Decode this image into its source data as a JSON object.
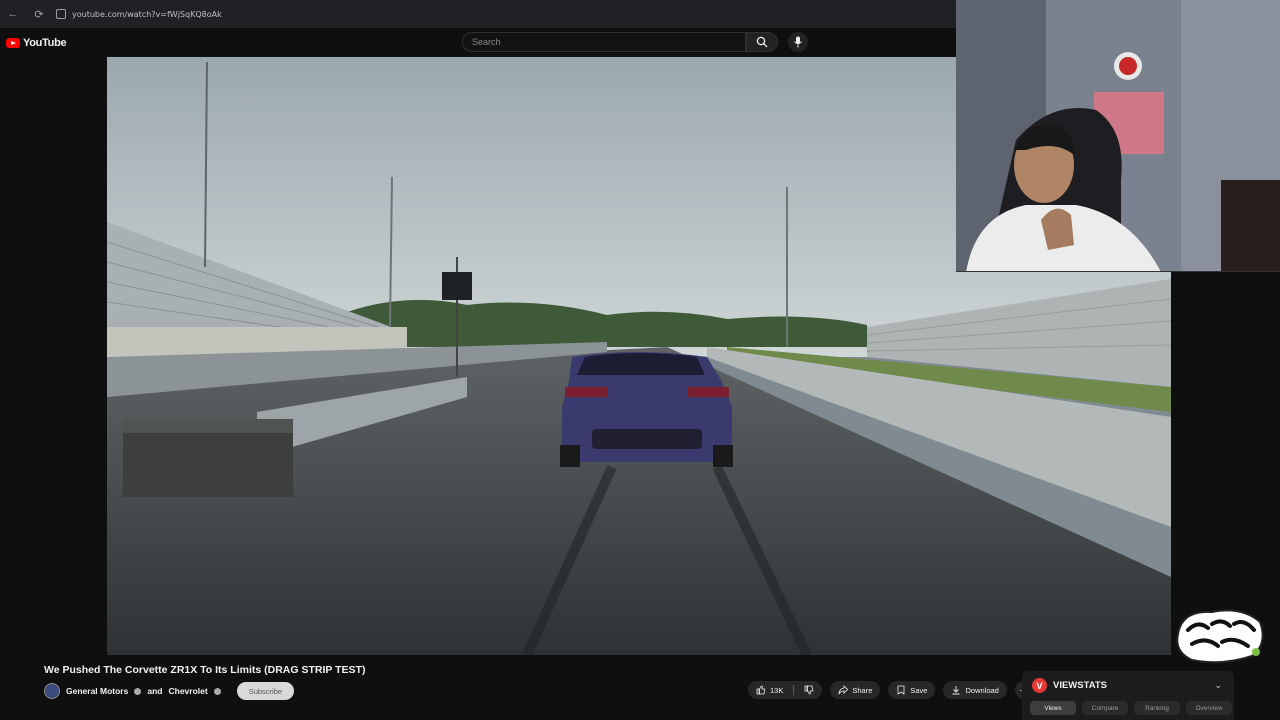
{
  "browser": {
    "url": "youtube.com/watch?v=fWjSqKQ8oAk"
  },
  "header": {
    "logo_text": "YouTube",
    "search_placeholder": "Search"
  },
  "video": {
    "title": "We Pushed The Corvette ZR1X To Its Limits (DRAG STRIP TEST)",
    "channel": "General Motors",
    "collab_sep": "and",
    "collab": "Chevrolet",
    "subscribe_label": "Subscribe"
  },
  "actions": {
    "likes": "13K",
    "share_label": "Share",
    "save_label": "Save",
    "download_label": "Download"
  },
  "viewstats": {
    "logo_letter": "V",
    "title": "VIEWSTATS",
    "tabs": [
      {
        "label": "Views",
        "active": true
      },
      {
        "label": "Compare",
        "active": false
      },
      {
        "label": "Ranking",
        "active": false
      },
      {
        "label": "Overview",
        "active": false
      }
    ]
  },
  "colors": {
    "brand_red": "#ff0000",
    "viewstats_red": "#e53935",
    "bg": "#0f0f0f"
  },
  "icons": [
    "back-icon",
    "reload-icon",
    "search-icon",
    "mic-icon",
    "like-icon",
    "dislike-icon",
    "share-icon",
    "save-icon",
    "download-icon",
    "more-icon",
    "chevron-down-icon"
  ]
}
